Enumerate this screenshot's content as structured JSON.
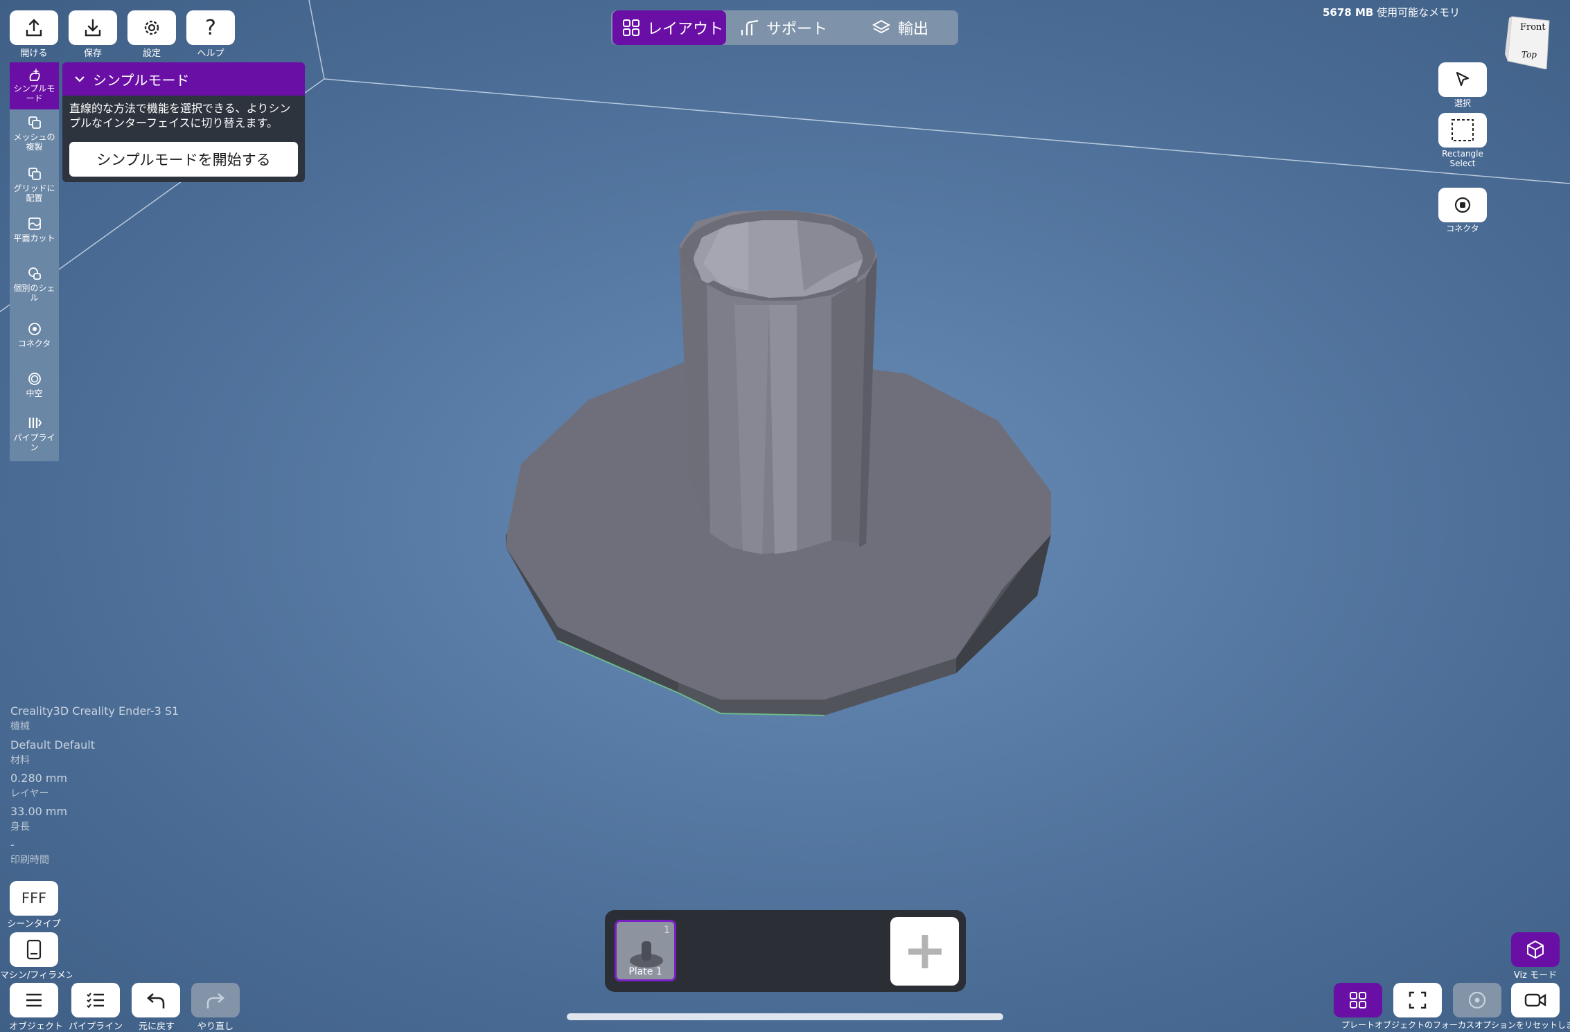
{
  "header": {
    "memory_value": "5678 MB",
    "memory_label": "使用可能なメモリ"
  },
  "top_left": {
    "open": "開ける",
    "save": "保存",
    "settings": "設定",
    "help": "ヘルプ",
    "help_glyph": "?"
  },
  "tabs": {
    "layout": "レイアウト",
    "support": "サポート",
    "export": "輸出"
  },
  "left_toolbar": {
    "simple_mode": "シンプルモード",
    "mesh_copy": "メッシュの複製",
    "grid_place": "グリッドに配置",
    "plane_cut": "平面カット",
    "separate_shell": "個別のシェル",
    "connector": "コネクタ",
    "hollow": "中空",
    "pipeline": "パイプライン"
  },
  "panel": {
    "title": "シンプルモード",
    "description": "直線的な方法で機能を選択できる、よりシンプルなインターフェイスに切り替えます。",
    "start_button": "シンプルモードを開始する"
  },
  "info": {
    "machine_value": "Creality3D Creality Ender-3 S1",
    "machine_label": "機械",
    "material_value": "Default Default",
    "material_label": "材料",
    "layer_value": "0.280 mm",
    "layer_label": "レイヤー",
    "height_value": "33.00 mm",
    "height_label": "身長",
    "print_time_value": "-",
    "print_time_label": "印刷時間"
  },
  "bottom_left": {
    "scene_type_button": "FFF",
    "scene_type_label": "シーンタイプ",
    "machine_filament_label": "マシン/フィラメント",
    "objects_label": "オブジェクト",
    "pipeline_label": "パイプライン",
    "undo_label": "元に戻す",
    "redo_label": "やり直し"
  },
  "right_tools": {
    "select": "選択",
    "rect_select": "Rectangle Select",
    "connector": "コネクタ",
    "cube_front": "Front",
    "cube_top": "Top"
  },
  "plates": {
    "items": [
      {
        "number": "1",
        "name": "Plate 1"
      }
    ]
  },
  "bottom_right": {
    "viz_label": "Viz モード",
    "footer_text": "プレートオブジェクトのフォーカスオプションをリセットします"
  },
  "colors": {
    "accent": "#6a0fa5",
    "viewport": "#5a7ea8",
    "model": "#7a7a86"
  }
}
